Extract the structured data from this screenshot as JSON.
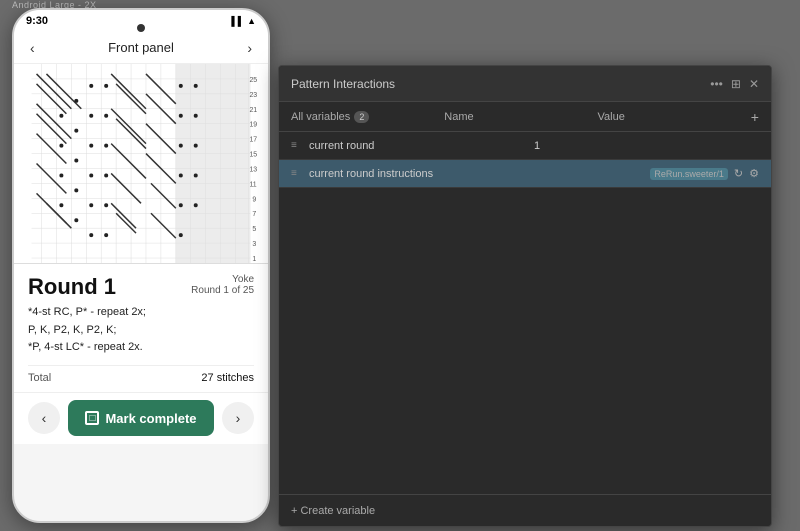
{
  "device": {
    "label": "Android Large - 2X",
    "status_bar": {
      "time": "9:30",
      "signal": "▌▌",
      "wifi": "▲"
    },
    "nav": {
      "title": "Front panel",
      "back_label": "‹",
      "forward_label": "›"
    },
    "row_numbers": [
      "25",
      "23",
      "21",
      "19",
      "17",
      "15",
      "13",
      "11",
      "9",
      "7",
      "5",
      "3",
      "1"
    ],
    "round": {
      "title": "Round 1",
      "section": "Yoke",
      "sub": "Round 1 of 25",
      "instructions": [
        "*4-st RC, P* - repeat 2x;",
        "P, K, P2, K, P2, K;",
        "*P, 4-st LC* - repeat 2x."
      ],
      "total_label": "Total",
      "stitch_count": "27 stitches"
    },
    "bottom_nav": {
      "back": "‹",
      "forward": "›",
      "mark_complete": "Mark complete"
    }
  },
  "panel": {
    "title": "Pattern Interactions",
    "icons": {
      "more": "•••",
      "layout": "⊞",
      "close": "✕"
    },
    "table": {
      "filter_label": "All variables",
      "filter_count": "2",
      "col_name": "Name",
      "col_value": "Value",
      "add_icon": "+",
      "rows": [
        {
          "id": "1",
          "icon": "≡",
          "name": "current round",
          "value": "1",
          "selected": false
        },
        {
          "id": "2",
          "icon": "≡",
          "name": "current round instructions",
          "value": "ReRun.sweeter/1",
          "selected": true
        }
      ]
    },
    "footer": {
      "create_variable": "+ Create variable"
    }
  }
}
